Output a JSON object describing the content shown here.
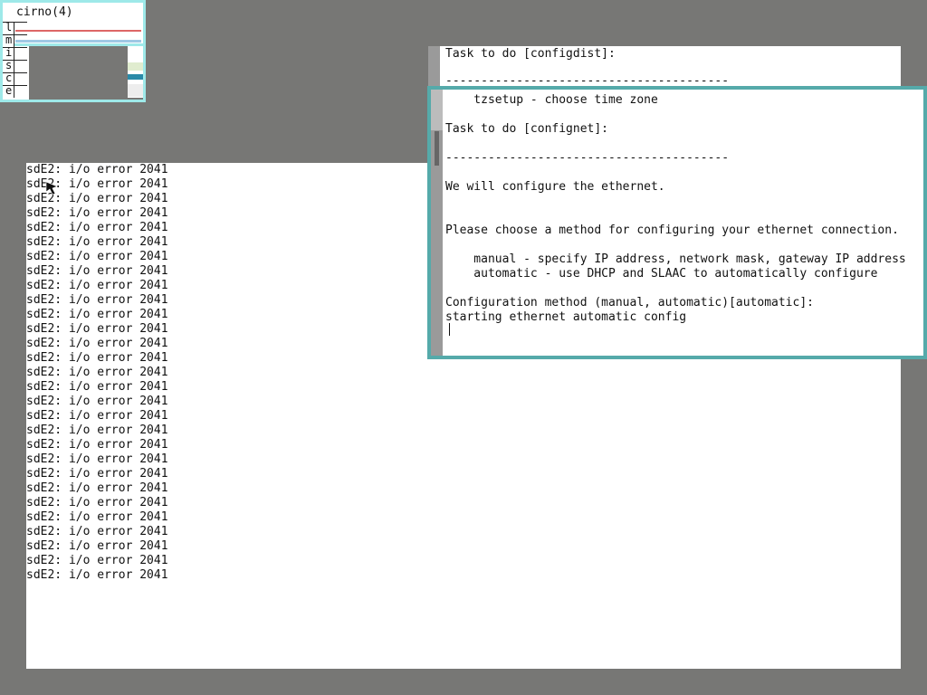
{
  "stats": {
    "title": "cirno(4)",
    "labels": [
      "l",
      "m",
      "i",
      "s",
      "c",
      "e"
    ]
  },
  "console": {
    "lines": [
      "sdE2: i/o error 2041",
      "sdE2: i/o error 2041",
      "sdE2: i/o error 2041",
      "sdE2: i/o error 2041",
      "sdE2: i/o error 2041",
      "sdE2: i/o error 2041",
      "sdE2: i/o error 2041",
      "sdE2: i/o error 2041",
      "sdE2: i/o error 2041",
      "sdE2: i/o error 2041",
      "sdE2: i/o error 2041",
      "sdE2: i/o error 2041",
      "sdE2: i/o error 2041",
      "sdE2: i/o error 2041",
      "sdE2: i/o error 2041",
      "sdE2: i/o error 2041",
      "sdE2: i/o error 2041",
      "sdE2: i/o error 2041",
      "sdE2: i/o error 2041",
      "sdE2: i/o error 2041",
      "sdE2: i/o error 2041",
      "sdE2: i/o error 2041",
      "sdE2: i/o error 2041",
      "sdE2: i/o error 2041",
      "sdE2: i/o error 2041",
      "sdE2: i/o error 2041",
      "sdE2: i/o error 2041",
      "sdE2: i/o error 2041",
      "sdE2: i/o error 2041"
    ]
  },
  "back_window": {
    "task_line": "Task to do [configdist]:",
    "rule": "----------------------------------------"
  },
  "front_window": {
    "lines": [
      "    tzsetup - choose time zone",
      "",
      "Task to do [confignet]:",
      "",
      "----------------------------------------",
      "",
      "We will configure the ethernet.",
      "",
      "",
      "Please choose a method for configuring your ethernet connection.",
      "",
      "    manual - specify IP address, network mask, gateway IP address",
      "    automatic - use DHCP and SLAAC to automatically configure",
      "",
      "Configuration method (manual, automatic)[automatic]:",
      "starting ethernet automatic config"
    ]
  },
  "colors": {
    "desktop": "#777775",
    "border_active": "#55aaaa",
    "border_stats": "#9ee9e9"
  }
}
